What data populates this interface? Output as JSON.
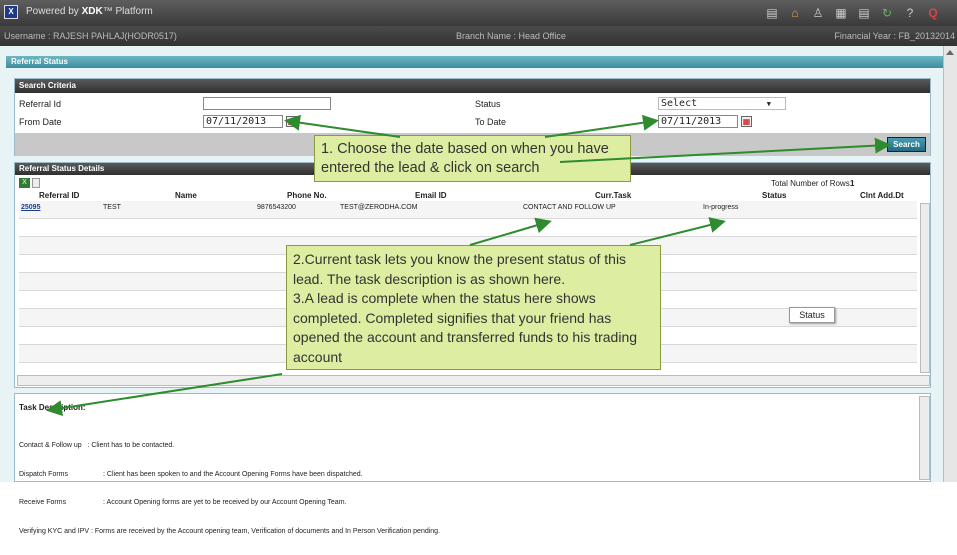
{
  "topbar": {
    "brand_prefix": "Powered by ",
    "brand": "XDK",
    "brand_suffix": "™ Platform"
  },
  "userbar": {
    "username": "Username : RAJESH PAHLAJ(HODR0517)",
    "branch": "Branch Name : Head Office",
    "fy": "Financial Year : FB_20132014"
  },
  "panel_title": "Referral Status",
  "search": {
    "title": "Search Criteria",
    "referral_id_label": "Referral Id",
    "referral_id_value": "",
    "status_label": "Status",
    "status_value": "Select",
    "from_date_label": "From Date",
    "from_date_value": "07/11/2013",
    "to_date_label": "To Date",
    "to_date_value": "07/11/2013",
    "search_button": "Search"
  },
  "details": {
    "title": "Referral Status Details",
    "total_label": "Total Number of Rows :",
    "total_value": "1",
    "columns": [
      "Referral ID",
      "Name",
      "Phone No.",
      "Email ID",
      "Curr.Task",
      "Status",
      "Clnt Add.Dt"
    ],
    "row": {
      "id": "25095",
      "name": "TEST",
      "phone": "9876543200",
      "email": "TEST@ZERODHA.COM",
      "task": "CONTACT AND FOLLOW UP",
      "status": "In-progress",
      "date": ""
    }
  },
  "task_description": {
    "title": "Task Description:",
    "lines": [
      "Contact & Follow up   : Client has to be contacted.",
      "Dispatch Forms                  : Client has been spoken to and the Account Opening Forms have been dispatched.",
      "Receive Forms                   : Account Opening forms are yet to be received by our Account Opening Team.",
      "Verifying KYC and IPV : Forms are received by the Account opening team, Verification of documents and In Person Verification pending."
    ]
  },
  "callouts": {
    "one": "1. Choose the date based on when you have entered the lead & click on search",
    "two": "2.Current task lets you know the present status of this lead. The task description is as shown here.",
    "three": "3.A lead is complete when the status here shows completed. Completed signifies that your friend has opened the account and transferred funds to his trading account"
  },
  "tooltip": "Status",
  "colors": {
    "accent": "#3d8d9e",
    "callout": "#ddeea3",
    "arrow": "#2e8b2e"
  }
}
